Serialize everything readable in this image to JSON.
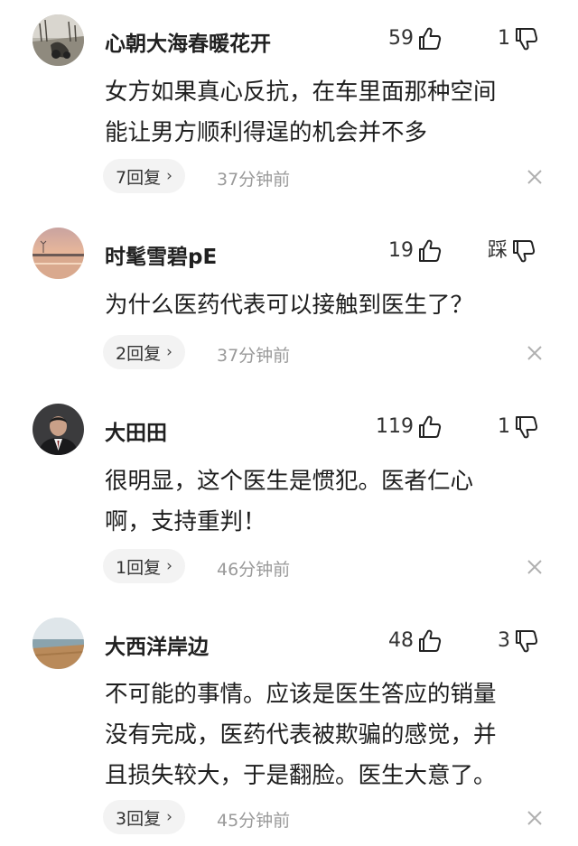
{
  "comments": [
    {
      "username": "心朝大海春暖花开",
      "likes": "59",
      "dislikes": "1",
      "lines": [
        "女方如果真心反抗，在车里面那种空间",
        "能让男方顺利得逞的机会并不多"
      ],
      "replies": "7回复",
      "time": "37分钟前",
      "avatar_icon": "winter-landscape-avatar-icon"
    },
    {
      "username": "时髦雪碧pE",
      "likes": "19",
      "dislikes": "踩",
      "lines": [
        "为什么医药代表可以接触到医生了？"
      ],
      "replies": "2回复",
      "time": "37分钟前",
      "avatar_icon": "sunset-lake-avatar-icon"
    },
    {
      "username": "大田田",
      "likes": "119",
      "dislikes": "1",
      "lines": [
        "很明显，这个医生是惯犯。医者仁心",
        "啊，支持重判！"
      ],
      "replies": "1回复",
      "time": "46分钟前",
      "avatar_icon": "man-in-suit-avatar-icon"
    },
    {
      "username": "大西洋岸边",
      "likes": "48",
      "dislikes": "3",
      "lines": [
        "不可能的事情。应该是医生答应的销量",
        "没有完成，医药代表被欺骗的感觉，并",
        "且损失较大，于是翻脸。医生大意了。"
      ],
      "replies": "3回复",
      "time": "45分钟前",
      "avatar_icon": "beach-avatar-icon"
    }
  ],
  "icons": {
    "like": "thumbs-up-icon",
    "dislike": "thumbs-down-icon",
    "chevron": "›",
    "close": "close-icon"
  },
  "colors": {
    "text": "#1e1e1e",
    "muted": "#9a9a9a",
    "pill_bg": "#f3f3f3"
  }
}
